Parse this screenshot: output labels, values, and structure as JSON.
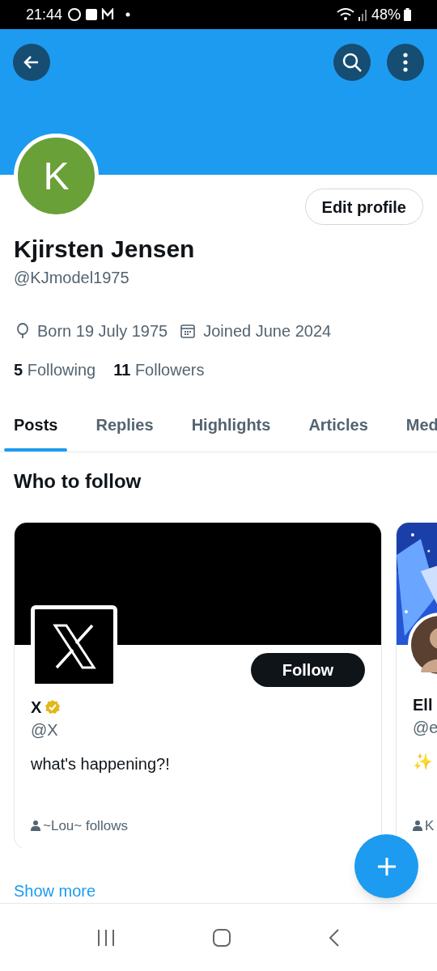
{
  "status_bar": {
    "time": "21:44",
    "battery": "48%"
  },
  "profile": {
    "avatar_letter": "K",
    "edit_button": "Edit profile",
    "name": "Kjirsten Jensen",
    "handle": "@KJmodel1975",
    "born": "Born 19 July 1975",
    "joined": "Joined June 2024",
    "following_count": "5",
    "following_label": "Following",
    "followers_count": "11",
    "followers_label": "Followers"
  },
  "tabs": [
    {
      "label": "Posts",
      "selected": true
    },
    {
      "label": "Replies",
      "selected": false
    },
    {
      "label": "Highlights",
      "selected": false
    },
    {
      "label": "Articles",
      "selected": false
    },
    {
      "label": "Med",
      "selected": false
    }
  ],
  "who_to_follow": {
    "title": "Who to follow",
    "cards": [
      {
        "kind": "full",
        "name": "X",
        "verified": true,
        "handle": "@X",
        "bio": "what's happening?!",
        "follow_button": "Follow",
        "followed_by": "~Lou~ follows"
      },
      {
        "kind": "partial",
        "name": "Ell",
        "verified": false,
        "handle": "@e",
        "bio": "✨",
        "followed_by": "K"
      }
    ]
  },
  "show_more": "Show more"
}
